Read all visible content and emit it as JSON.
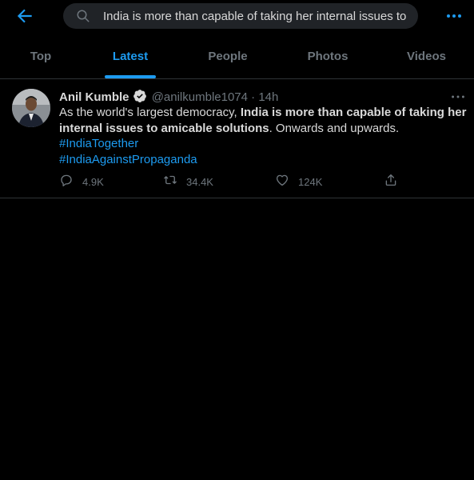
{
  "search": {
    "query": "India is more than capable of taking her internal issues to",
    "back_icon": "arrow-left-icon",
    "search_icon": "magnifier-icon",
    "more_icon": "more-dots-icon"
  },
  "tabs": [
    {
      "label": "Top",
      "active": false
    },
    {
      "label": "Latest",
      "active": true
    },
    {
      "label": "People",
      "active": false
    },
    {
      "label": "Photos",
      "active": false
    },
    {
      "label": "Videos",
      "active": false
    }
  ],
  "tweet": {
    "author_name": "Anil Kumble",
    "handle": "@anilkumble1074",
    "separator": "·",
    "time": "14h",
    "text_part1": "As the world's largest democracy, ",
    "text_bold": "India is more than capable of taking her internal issues to amicable solutions",
    "text_part2": ". Onwards and upwards.",
    "hashtags": [
      "#IndiaTogether",
      "#IndiaAgainstPropaganda"
    ],
    "reply_count": "4.9K",
    "retweet_count": "34.4K",
    "like_count": "124K"
  },
  "colors": {
    "background": "#000000",
    "accent": "#1d9bf0",
    "text": "#d9d9d9",
    "muted": "#6e767d",
    "divider": "#2f3336"
  }
}
